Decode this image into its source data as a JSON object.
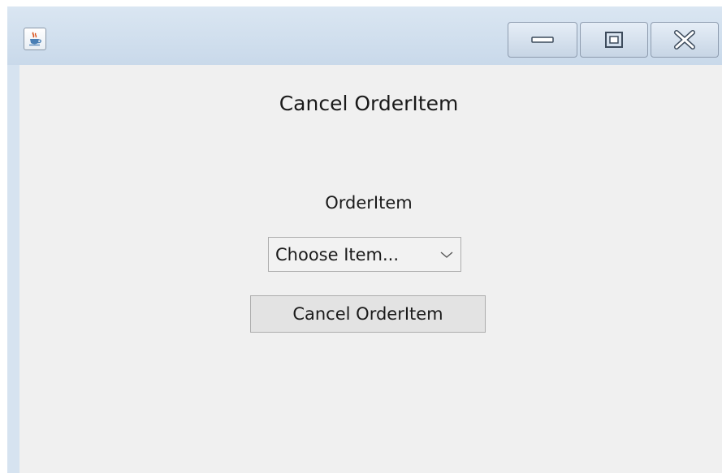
{
  "window": {
    "controls": {
      "minimize_icon": "minimize-icon",
      "maximize_icon": "maximize-icon",
      "close_icon": "close-icon"
    },
    "app_icon": "java-coffee-cup-icon"
  },
  "main": {
    "title": "Cancel OrderItem",
    "orderitem_label": "OrderItem",
    "orderitem_select": {
      "selected": "Choose Item..."
    },
    "cancel_button_label": "Cancel OrderItem"
  },
  "colors": {
    "titlebar": "#d6e3f0",
    "content_background": "#f0f0f0",
    "button_background": "#e3e3e3",
    "border": "#adadad"
  }
}
